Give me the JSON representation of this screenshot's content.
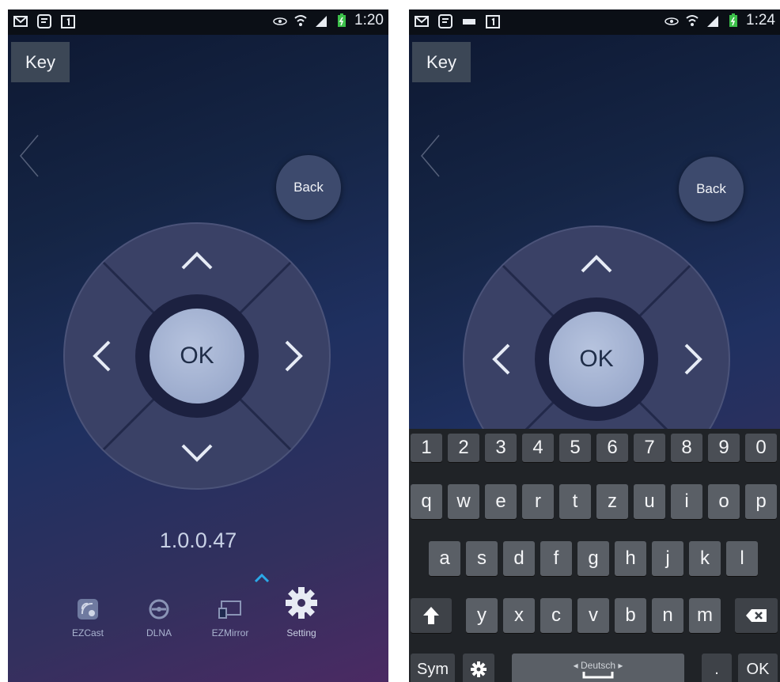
{
  "left_screen": {
    "status_time": "1:20",
    "key_button": "Key",
    "back_button": "Back",
    "ok_button": "OK",
    "version": "1.0.0.47",
    "nav": [
      {
        "label": "EZCast",
        "icon": "ezcast-icon"
      },
      {
        "label": "DLNA",
        "icon": "dlna-icon"
      },
      {
        "label": "EZMirror",
        "icon": "ezmirror-icon"
      },
      {
        "label": "Setting",
        "icon": "gear-icon"
      }
    ]
  },
  "right_screen": {
    "status_time": "1:24",
    "key_button": "Key",
    "back_button": "Back",
    "ok_button": "OK",
    "keyboard": {
      "numbers": [
        "1",
        "2",
        "3",
        "4",
        "5",
        "6",
        "7",
        "8",
        "9",
        "0"
      ],
      "row1": [
        "q",
        "w",
        "e",
        "r",
        "t",
        "z",
        "u",
        "i",
        "o",
        "p"
      ],
      "row2": [
        "a",
        "s",
        "d",
        "f",
        "g",
        "h",
        "j",
        "k",
        "l"
      ],
      "row3": [
        "y",
        "x",
        "c",
        "v",
        "b",
        "n",
        "m"
      ],
      "sym_label": "Sym",
      "space_label": "◂ Deutsch ▸",
      "ok_label": "OK",
      "period_label": "."
    }
  },
  "colors": {
    "background_top": "#0d1730",
    "background_bottom": "#4b2a63",
    "accent_caret": "#2aa9e8"
  }
}
